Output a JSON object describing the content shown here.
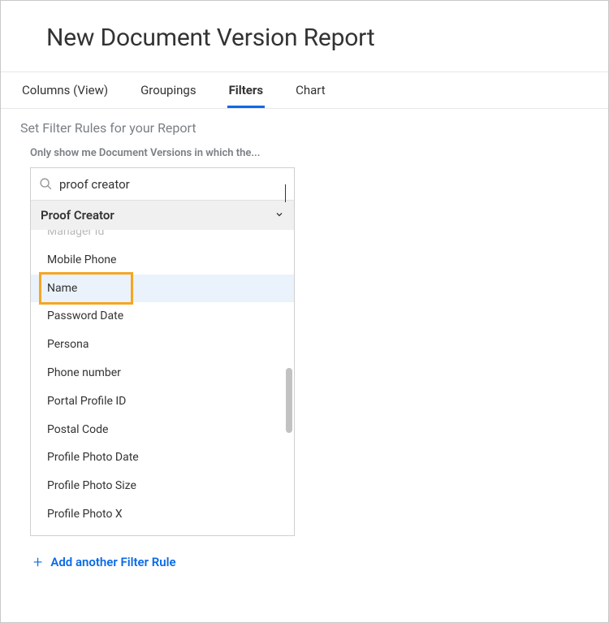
{
  "header": {
    "title": "New Document Version Report"
  },
  "tabs": {
    "columns": "Columns (View)",
    "groupings": "Groupings",
    "filters": "Filters",
    "chart": "Chart"
  },
  "filter": {
    "section_title": "Set Filter Rules for your Report",
    "subhead": "Only show me Document Versions in which the...",
    "search_value": "proof creator",
    "category": "Proof Creator",
    "items": {
      "partial_top": "Manager Id",
      "mobile_phone": "Mobile Phone",
      "name": "Name",
      "password_date": "Password Date",
      "persona": "Persona",
      "phone_number": "Phone number",
      "portal_profile_id": "Portal Profile ID",
      "postal_code": "Postal Code",
      "profile_photo_date": "Profile Photo Date",
      "profile_photo_size": "Profile Photo Size",
      "profile_photo_x": "Profile Photo X"
    },
    "add_rule": "Add another Filter Rule"
  }
}
